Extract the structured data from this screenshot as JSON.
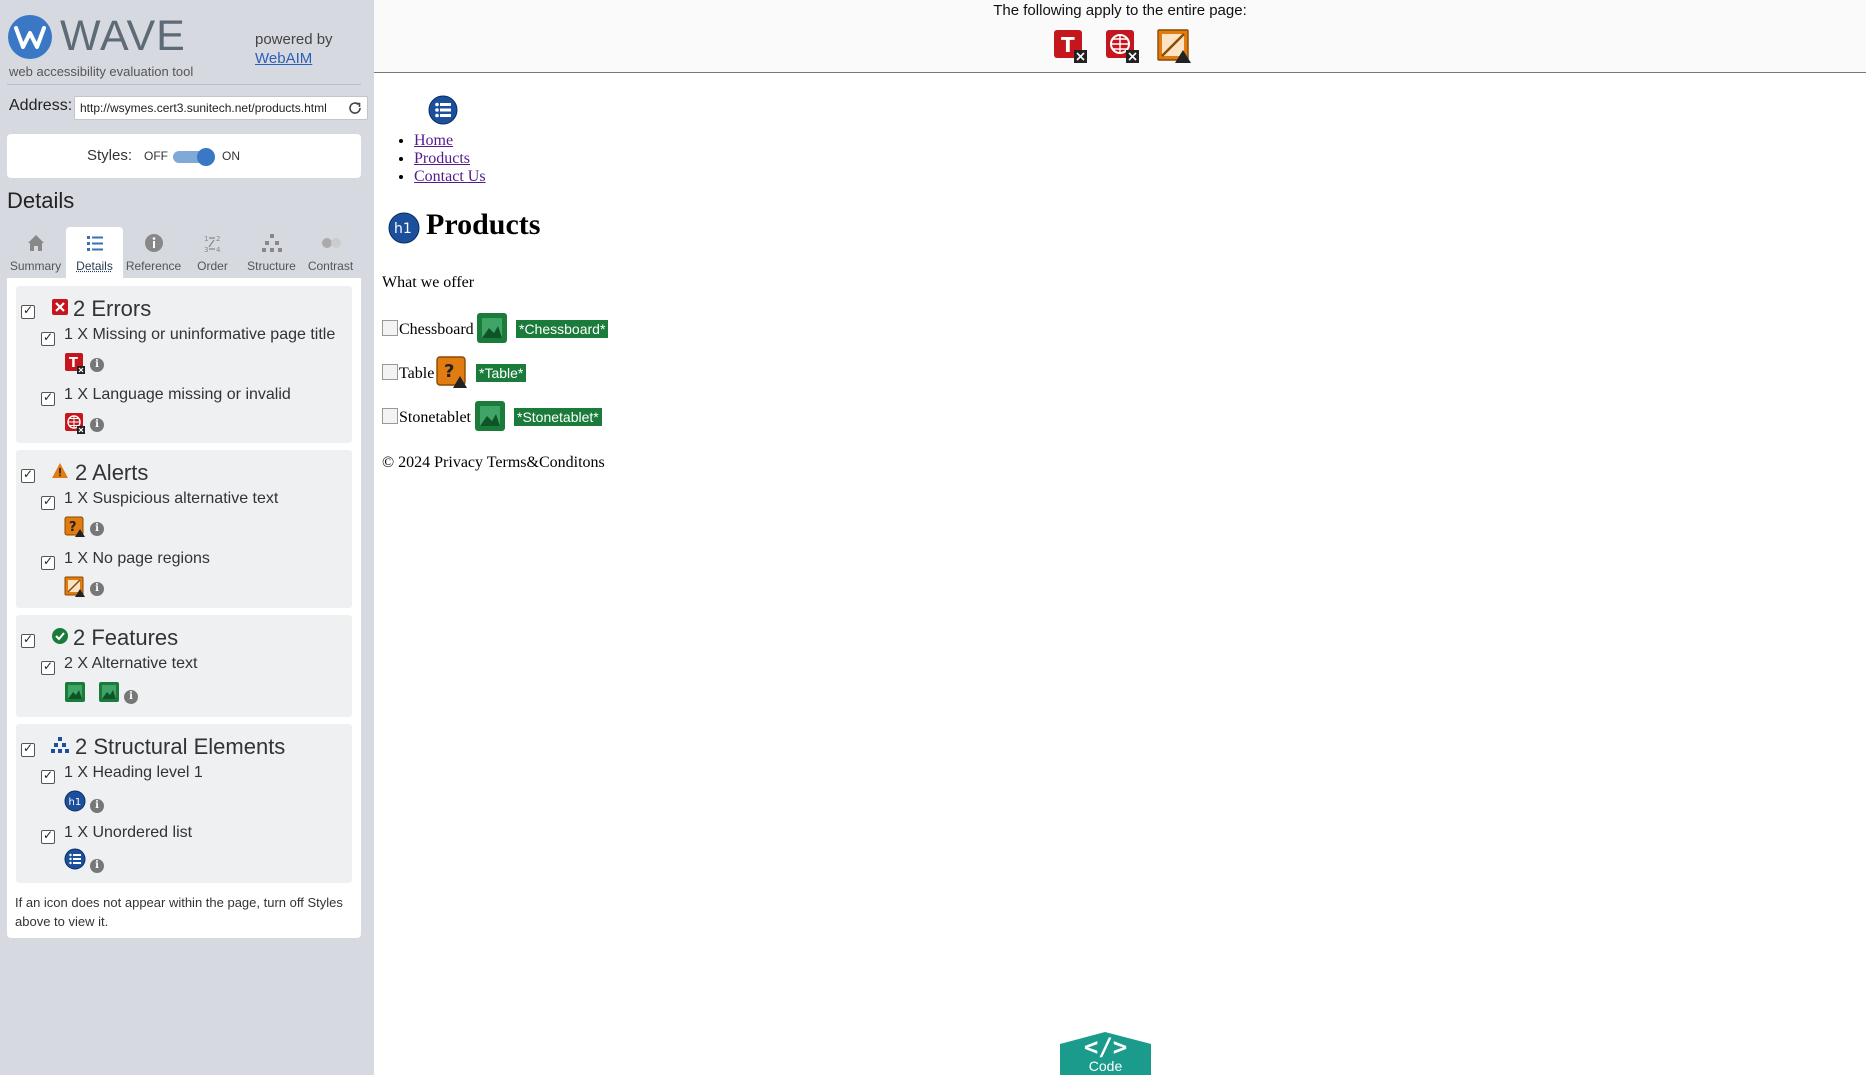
{
  "brand": {
    "name": "WAVE",
    "tagline": "web accessibility evaluation tool",
    "powered_by": "powered by",
    "webaim_link": "WebAIM"
  },
  "address": {
    "label": "Address:",
    "value": "http://wsymes.cert3.sunitech.net/products.html"
  },
  "styles": {
    "label": "Styles:",
    "off": "OFF",
    "on": "ON",
    "state": "on"
  },
  "details_heading": "Details",
  "tabs": [
    {
      "label": "Summary",
      "icon": "home-icon",
      "active": false
    },
    {
      "label": "Details",
      "icon": "list-icon",
      "active": true
    },
    {
      "label": "Reference",
      "icon": "info-icon",
      "active": false
    },
    {
      "label": "Order",
      "icon": "order-icon",
      "active": false
    },
    {
      "label": "Structure",
      "icon": "structure-icon",
      "active": false
    },
    {
      "label": "Contrast",
      "icon": "contrast-icon",
      "active": false
    }
  ],
  "groups": {
    "errors": {
      "title": "2 Errors",
      "items": [
        {
          "text": "1 X Missing or uninformative page title",
          "icon": "missing-title-error-icon"
        },
        {
          "text": "1 X Language missing or invalid",
          "icon": "language-error-icon"
        }
      ]
    },
    "alerts": {
      "title": "2 Alerts",
      "items": [
        {
          "text": "1 X Suspicious alternative text",
          "icon": "suspicious-alt-alert-icon"
        },
        {
          "text": "1 X No page regions",
          "icon": "no-regions-alert-icon"
        }
      ]
    },
    "features": {
      "title": "2 Features",
      "items": [
        {
          "text": "2 X Alternative text",
          "icon": "alt-text-feature-icon"
        }
      ]
    },
    "structural": {
      "title": "2 Structural Elements",
      "items": [
        {
          "text": "1 X Heading level 1",
          "icon": "heading-h1-icon",
          "badge": "h1"
        },
        {
          "text": "1 X Unordered list",
          "icon": "unordered-list-icon"
        }
      ]
    }
  },
  "footer_note": "If an icon does not appear within the page, turn off Styles above to view it.",
  "banner": {
    "text": "The following apply to the entire page:",
    "icons": [
      "missing-title-error-icon",
      "language-error-icon",
      "no-regions-alert-icon"
    ]
  },
  "page": {
    "nav": [
      "Home",
      "Products",
      "Contact Us"
    ],
    "h1_badge": "h1",
    "heading": "Products",
    "intro": "What we offer",
    "images": [
      {
        "alt": "Chessboard",
        "flag": "*Chessboard*",
        "icon": "alt-text-feature-icon"
      },
      {
        "alt": "Table",
        "flag": "*Table*",
        "icon": "suspicious-alt-alert-icon"
      },
      {
        "alt": "Stonetablet",
        "flag": "*Stonetablet*",
        "icon": "alt-text-feature-icon"
      }
    ],
    "footer": "© 2024 Privacy Terms&Conditons"
  },
  "code_button": {
    "glyph": "</>",
    "label": "Code"
  },
  "colors": {
    "sidebar_bg": "#d6dae0",
    "error_red": "#c4161c",
    "alert_orange": "#e07c12",
    "feature_green": "#1b7b3b",
    "structure_blue": "#1c4f9c",
    "code_teal": "#1a9b8b"
  }
}
